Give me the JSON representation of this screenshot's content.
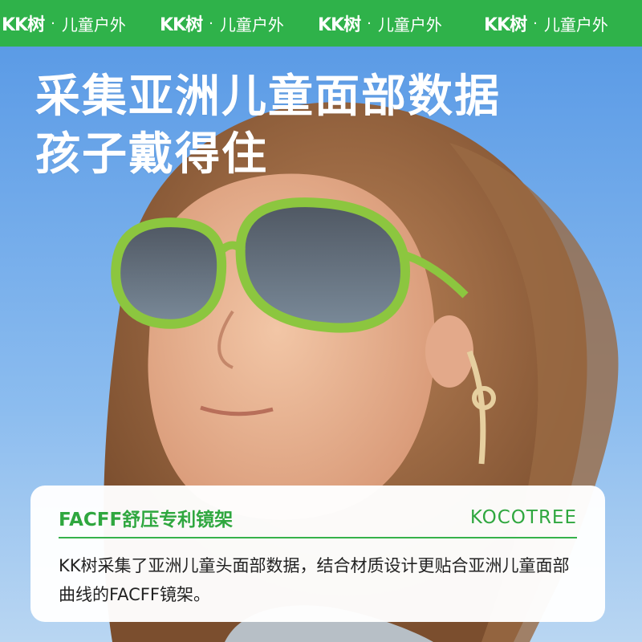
{
  "banner": {
    "items": [
      {
        "brand": "KK树",
        "sep": "·",
        "sub": "儿童户外"
      },
      {
        "brand": "KK树",
        "sep": "·",
        "sub": "儿童户外"
      },
      {
        "brand": "KK树",
        "sep": "·",
        "sub": "儿童户外"
      },
      {
        "brand": "KK树",
        "sep": "·",
        "sub": "儿童户外"
      }
    ],
    "color": "#2fb24a"
  },
  "headline": {
    "line1": "采集亚洲儿童面部数据",
    "line2": "孩子戴得住"
  },
  "card": {
    "title": "FACFF舒压专利镜架",
    "brand": "KOCOTREE",
    "body": "KK树采集了亚洲儿童头面部数据，结合材质设计更贴合亚洲儿童面部曲线的FACFF镜架。",
    "accent": "#2fa73f"
  },
  "photo": {
    "subject": "child wearing green sunglasses with ear strap",
    "sky_color": "#6fa6e6",
    "frame_color": "#8cc63f"
  }
}
